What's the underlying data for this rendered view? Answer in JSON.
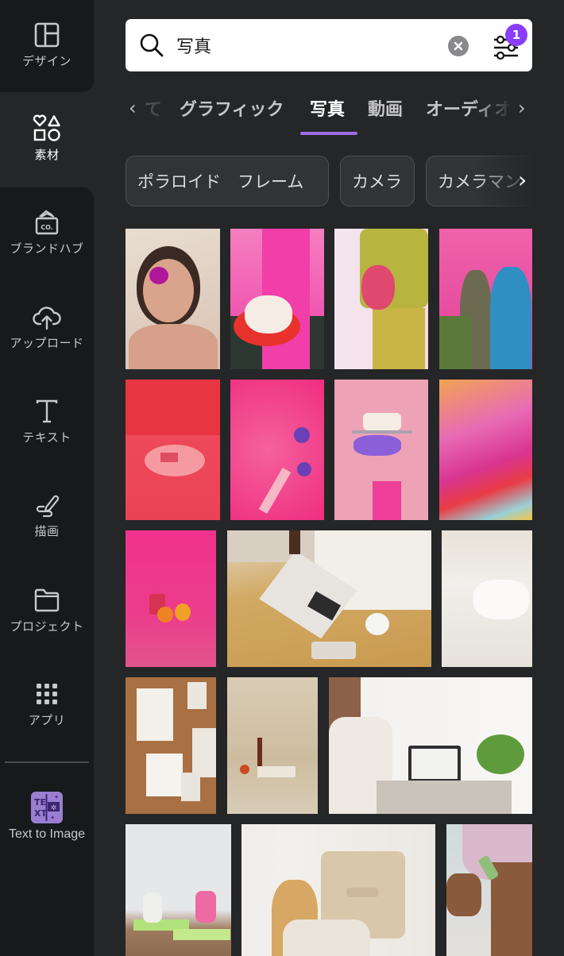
{
  "sidebar": {
    "items": [
      {
        "label": "デザイン",
        "icon": "layout-icon",
        "active": false
      },
      {
        "label": "素材",
        "icon": "elements-shapes-icon",
        "active": true
      },
      {
        "label": "ブランドハブ",
        "icon": "brand-hub-icon",
        "active": false
      },
      {
        "label": "アップロード",
        "icon": "cloud-upload-icon",
        "active": false
      },
      {
        "label": "テキスト",
        "icon": "text-icon",
        "active": false
      },
      {
        "label": "描画",
        "icon": "draw-icon",
        "active": false
      },
      {
        "label": "プロジェクト",
        "icon": "folder-icon",
        "active": false
      },
      {
        "label": "アプリ",
        "icon": "apps-grid-icon",
        "active": false
      }
    ],
    "app_item": {
      "label": "Text to Image",
      "icon": "text-to-image-app-icon",
      "icon_text": "TEXT"
    }
  },
  "search": {
    "value": "写真",
    "filter_badge_count": "1"
  },
  "tabs": {
    "prev_partial": "て",
    "items": [
      {
        "label": "グラフィック",
        "active": false
      },
      {
        "label": "写真",
        "active": true
      },
      {
        "label": "動画",
        "active": false
      },
      {
        "label": "オーディオ",
        "active": false
      }
    ],
    "accent_color": "#9d6ee8"
  },
  "chips": [
    {
      "label": "ポラロイド　フレーム"
    },
    {
      "label": "カメラ"
    },
    {
      "label": "カメラマン"
    }
  ],
  "photos": [
    {
      "row": 1,
      "description": "woman with pink orchid in hair"
    },
    {
      "row": 1,
      "description": "person in pink suit holding sprinkle cake"
    },
    {
      "row": 1,
      "description": "person in olive tracksuit holding pink pineapple"
    },
    {
      "row": 1,
      "description": "two women with flowers against pink backdrop"
    },
    {
      "row": 2,
      "description": "hands cutting pink dessert on pink plate"
    },
    {
      "row": 2,
      "description": "pink textured flatlay with feathers and flowers"
    },
    {
      "row": 2,
      "description": "purple high heel balancing birthday cake"
    },
    {
      "row": 2,
      "description": "abstract pink and red motion blur"
    },
    {
      "row": 3,
      "description": "pink drink with citrus fruit on pink backdrop"
    },
    {
      "row": 3,
      "description": "person using laptop at wooden desk with coffee"
    },
    {
      "row": 3,
      "description": "white rumpled bed sheets and pillow"
    },
    {
      "row": 4,
      "description": "cork moodboard with polaroid photos"
    },
    {
      "row": 4,
      "description": "beige drape still life with candle and books"
    },
    {
      "row": 4,
      "description": "woman signing to laptop video call"
    },
    {
      "row": 5,
      "description": "two women doing yoga on green mats"
    },
    {
      "row": 5,
      "description": "woman painting wall with roller"
    },
    {
      "row": 5,
      "description": "person using jade roller with face mask"
    }
  ],
  "colors": {
    "sidebar_bg": "#18191b",
    "panel_bg": "#252627",
    "badge": "#8b3dff",
    "app_icon": "#9a7fd0"
  }
}
